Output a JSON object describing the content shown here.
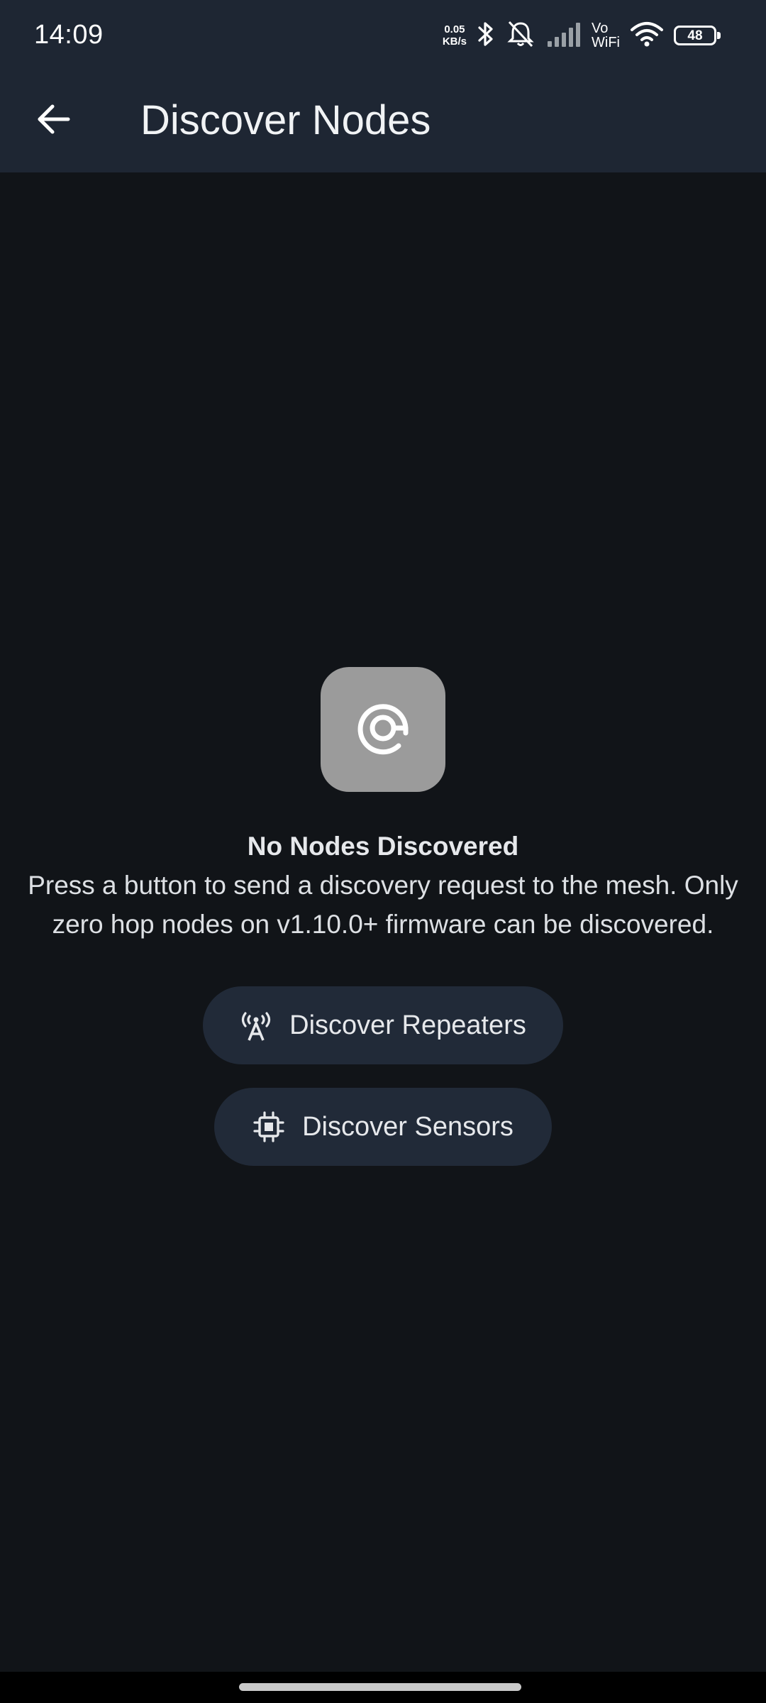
{
  "status_bar": {
    "time": "14:09",
    "net_speed_value": "0.05",
    "net_speed_unit": "KB/s",
    "vowifi_top": "Vo",
    "vowifi_bottom": "WiFi",
    "battery_level": "48"
  },
  "app_bar": {
    "title": "Discover Nodes"
  },
  "empty_state": {
    "title": "No Nodes Discovered",
    "description": "Press a button to send a discovery request to the mesh. Only zero hop nodes on v1.10.0+ firmware can be discovered."
  },
  "actions": {
    "discover_repeaters": "Discover Repeaters",
    "discover_sensors": "Discover Sensors"
  },
  "icons": {
    "back": "arrow-back-icon",
    "empty": "radar-icon",
    "repeaters": "radio-tower-icon",
    "sensors": "chip-icon"
  },
  "colors": {
    "app_bar": "#1e2633",
    "background": "#111418",
    "button": "#212a38",
    "icon_box": "#9b9b9b"
  }
}
